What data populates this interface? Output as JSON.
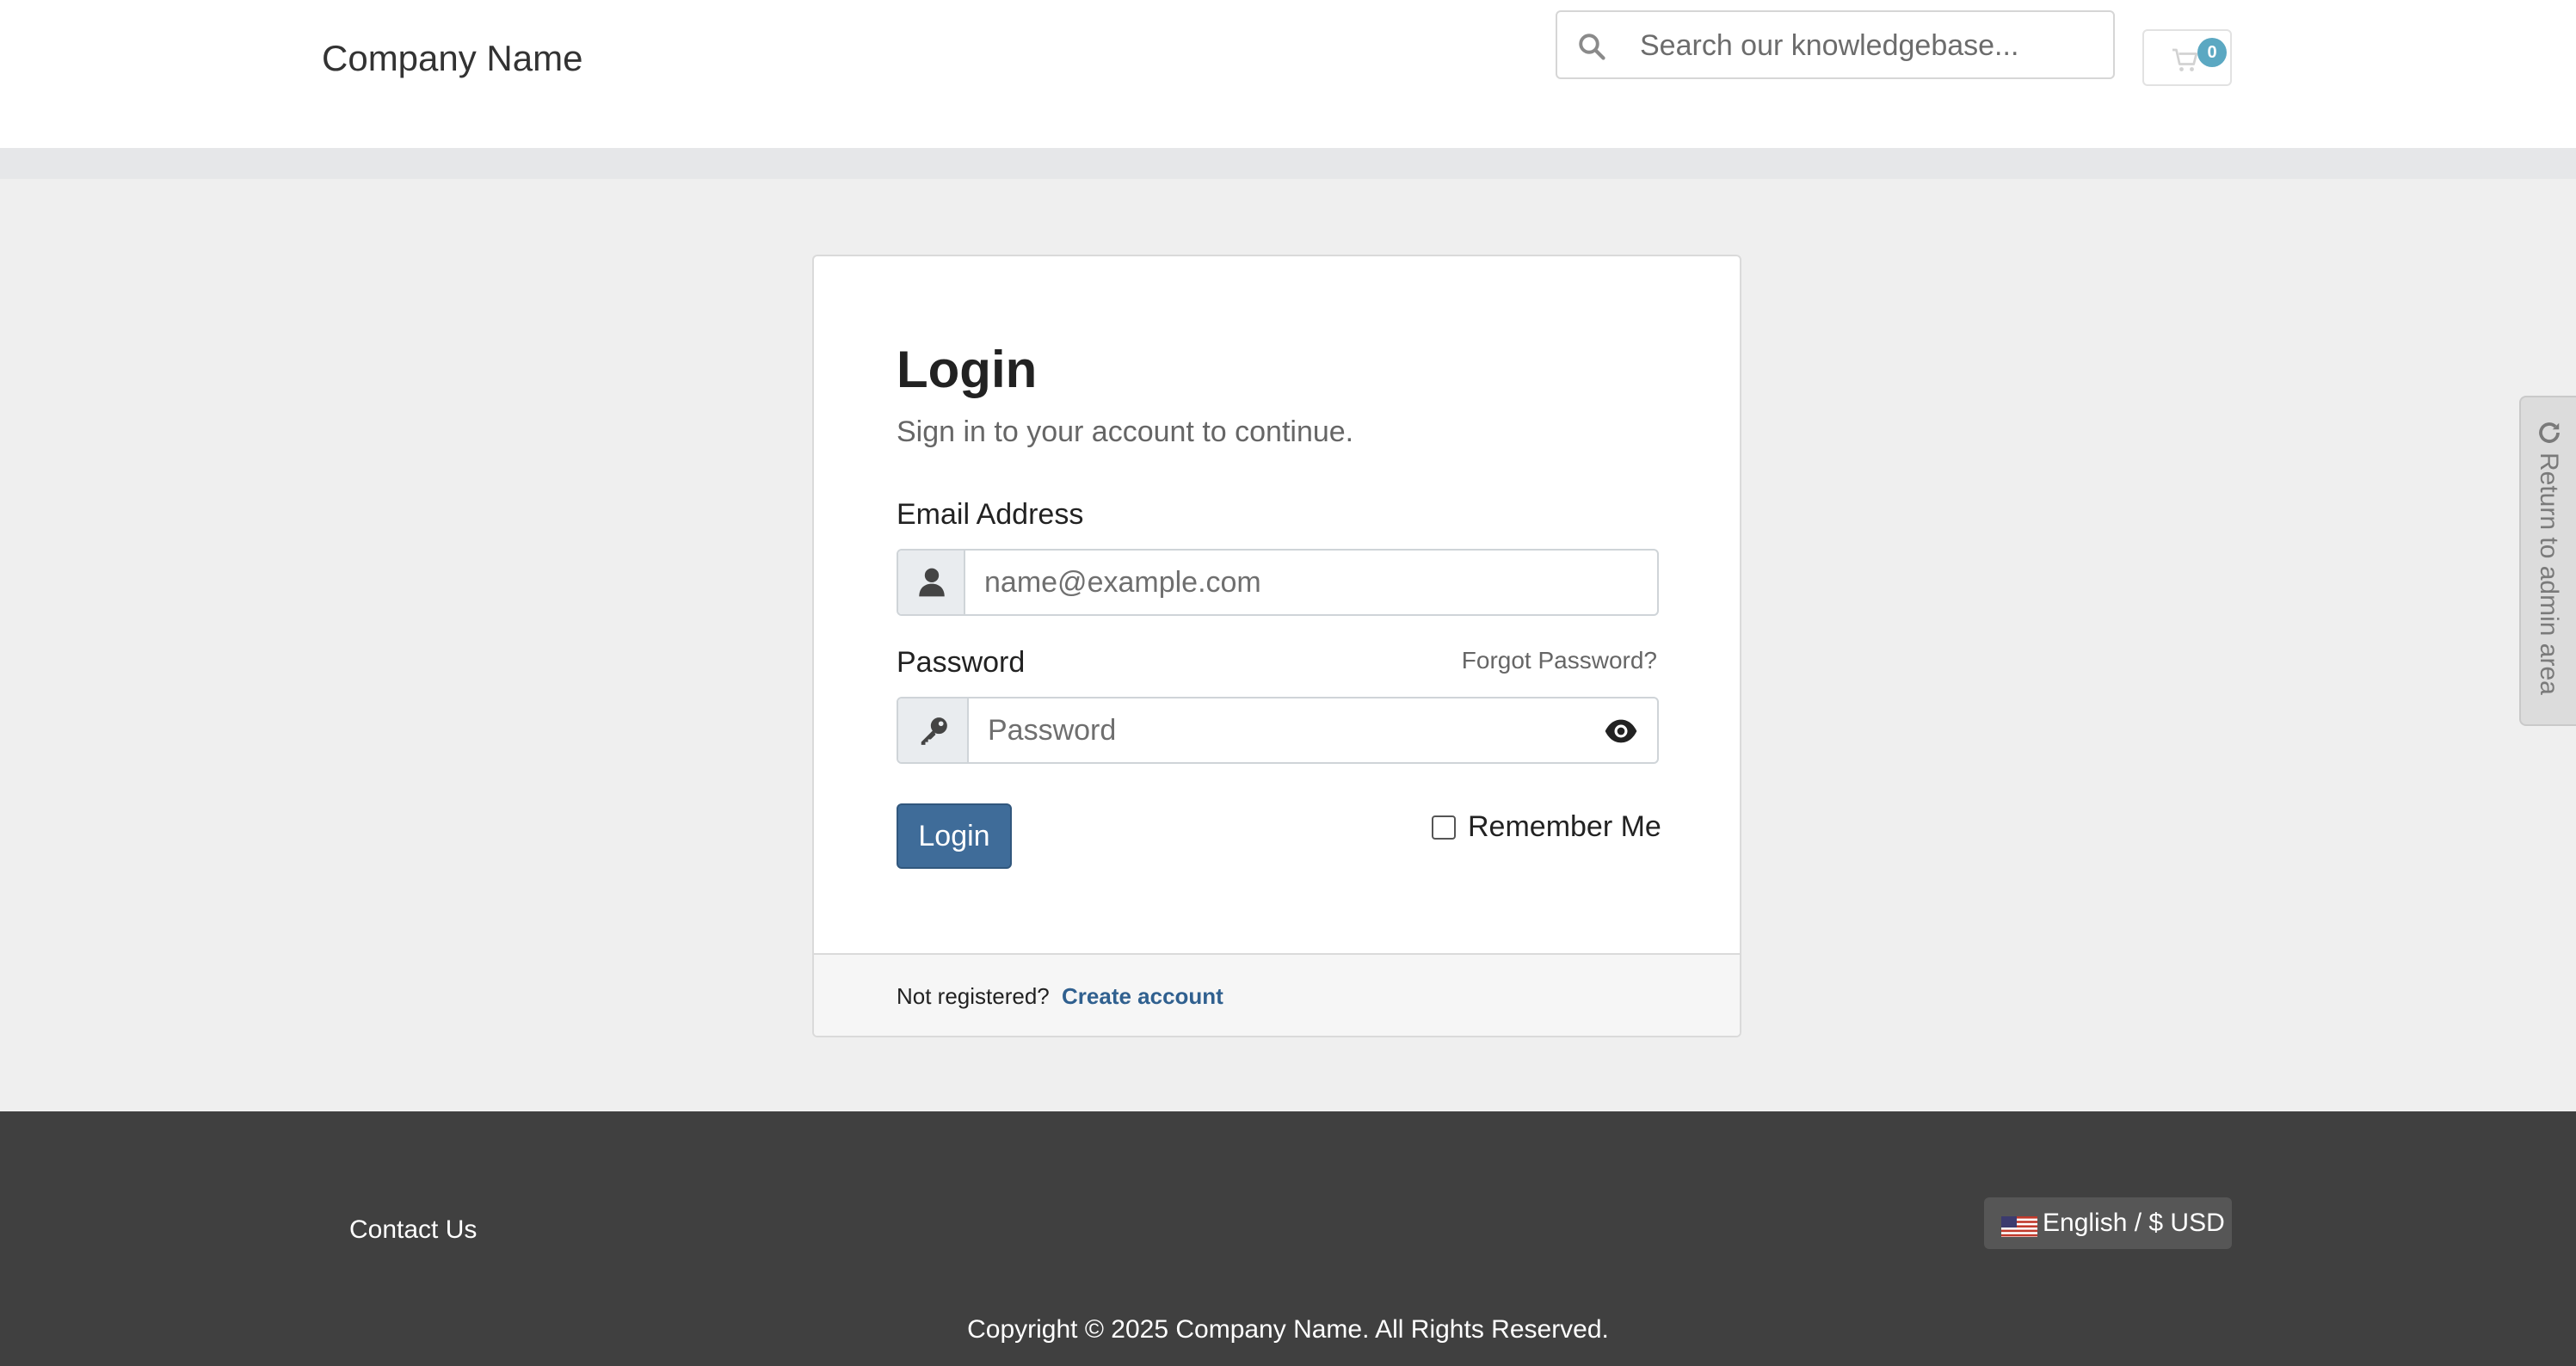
{
  "header": {
    "logo_text": "Company Name",
    "search": {
      "placeholder": "Search our knowledgebase..."
    },
    "cart": {
      "count": "0"
    }
  },
  "login_card": {
    "title": "Login",
    "subtitle": "Sign in to your account to continue.",
    "email": {
      "label": "Email Address",
      "placeholder": "name@example.com"
    },
    "password": {
      "label": "Password",
      "placeholder": "Password",
      "forgot_link": "Forgot Password?"
    },
    "login_button": "Login",
    "remember_me": {
      "label": "Remember Me",
      "checked": false
    },
    "footer": {
      "not_registered": "Not registered?",
      "create_account": "Create account"
    }
  },
  "admin_tab": {
    "label": "Return to admin area"
  },
  "footer": {
    "contact_link": "Contact Us",
    "language_currency": "English / $ USD",
    "copyright": "Copyright © 2025 Company Name. All Rights Reserved."
  },
  "colors": {
    "primary_button": "#3f6c99",
    "link": "#30608f",
    "cart_badge": "#5ba8c2",
    "footer_bg": "#404040",
    "page_bg": "#efefef"
  },
  "icons": [
    "search-icon",
    "cart-icon",
    "user-icon",
    "key-icon",
    "eye-icon",
    "refresh-icon",
    "us-flag-icon"
  ]
}
